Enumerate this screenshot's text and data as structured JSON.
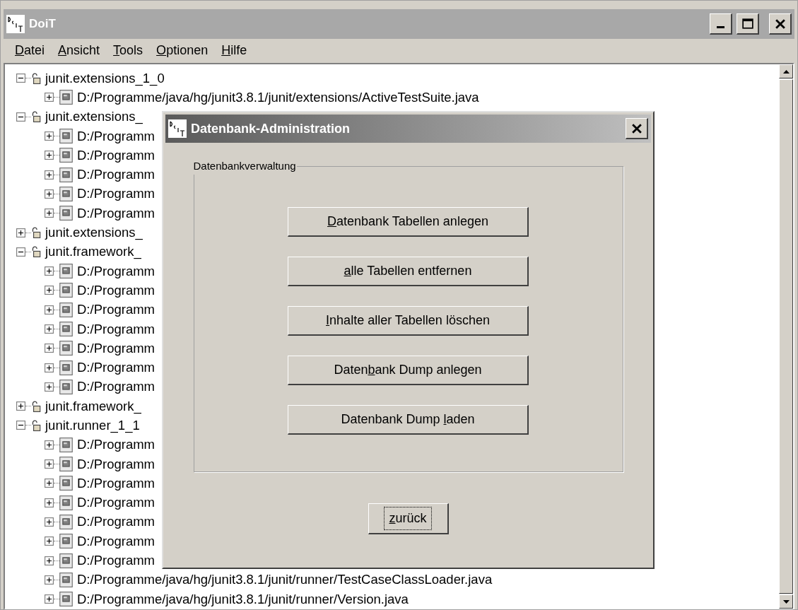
{
  "window": {
    "title": "DoiT"
  },
  "menu": [
    {
      "key": "D",
      "rest": "atei"
    },
    {
      "key": "A",
      "rest": "nsicht"
    },
    {
      "key": "T",
      "rest": "ools"
    },
    {
      "key": "O",
      "rest": "ptionen"
    },
    {
      "key": "H",
      "rest": "ilfe"
    }
  ],
  "tree": [
    {
      "label": "junit.extensions_1_0",
      "expanded": true,
      "children": [
        {
          "label": "D:/Programme/java/hg/junit3.8.1/junit/extensions/ActiveTestSuite.java",
          "expanded": false
        }
      ]
    },
    {
      "label": "junit.extensions_",
      "expanded": true,
      "children": [
        {
          "label": "D:/Programm",
          "expanded": false
        },
        {
          "label": "D:/Programm",
          "expanded": false
        },
        {
          "label": "D:/Programm",
          "expanded": false
        },
        {
          "label": "D:/Programm",
          "expanded": false
        },
        {
          "label": "D:/Programm",
          "expanded": false
        }
      ]
    },
    {
      "label": "junit.extensions_",
      "expanded": false
    },
    {
      "label": "junit.framework_",
      "expanded": true,
      "children": [
        {
          "label": "D:/Programm",
          "expanded": false
        },
        {
          "label": "D:/Programm",
          "expanded": false
        },
        {
          "label": "D:/Programm",
          "expanded": false
        },
        {
          "label": "D:/Programm",
          "expanded": false
        },
        {
          "label": "D:/Programm",
          "expanded": false
        },
        {
          "label": "D:/Programm",
          "expanded": false
        },
        {
          "label": "D:/Programm",
          "expanded": false
        }
      ]
    },
    {
      "label": "junit.framework_",
      "expanded": false
    },
    {
      "label": "junit.runner_1_1",
      "expanded": true,
      "children": [
        {
          "label": "D:/Programm",
          "expanded": false
        },
        {
          "label": "D:/Programm",
          "expanded": false
        },
        {
          "label": "D:/Programm",
          "expanded": false
        },
        {
          "label": "D:/Programm",
          "expanded": false
        },
        {
          "label": "D:/Programm",
          "expanded": false
        },
        {
          "label": "D:/Programm",
          "expanded": false
        },
        {
          "label": "D:/Programm",
          "expanded": false
        },
        {
          "label": "D:/Programme/java/hg/junit3.8.1/junit/runner/TestCaseClassLoader.java",
          "expanded": false
        },
        {
          "label": "D:/Programme/java/hg/junit3.8.1/junit/runner/Version.java",
          "expanded": false
        }
      ]
    }
  ],
  "dialog": {
    "title": "Datenbank-Administration",
    "group_title": "Datenbankverwaltung",
    "buttons": [
      {
        "key": "D",
        "post": "atenbank Tabellen anlegen"
      },
      {
        "key": "a",
        "post": "lle Tabellen entfernen"
      },
      {
        "key": "I",
        "post": "nhalte aller Tabellen löschen"
      },
      {
        "pre": "Daten",
        "key": "b",
        "post": "ank Dump anlegen"
      },
      {
        "pre": "Datenbank Dump ",
        "key": "l",
        "post": "aden"
      }
    ],
    "back_button": {
      "key": "z",
      "post": "urück",
      "focused": true
    }
  }
}
